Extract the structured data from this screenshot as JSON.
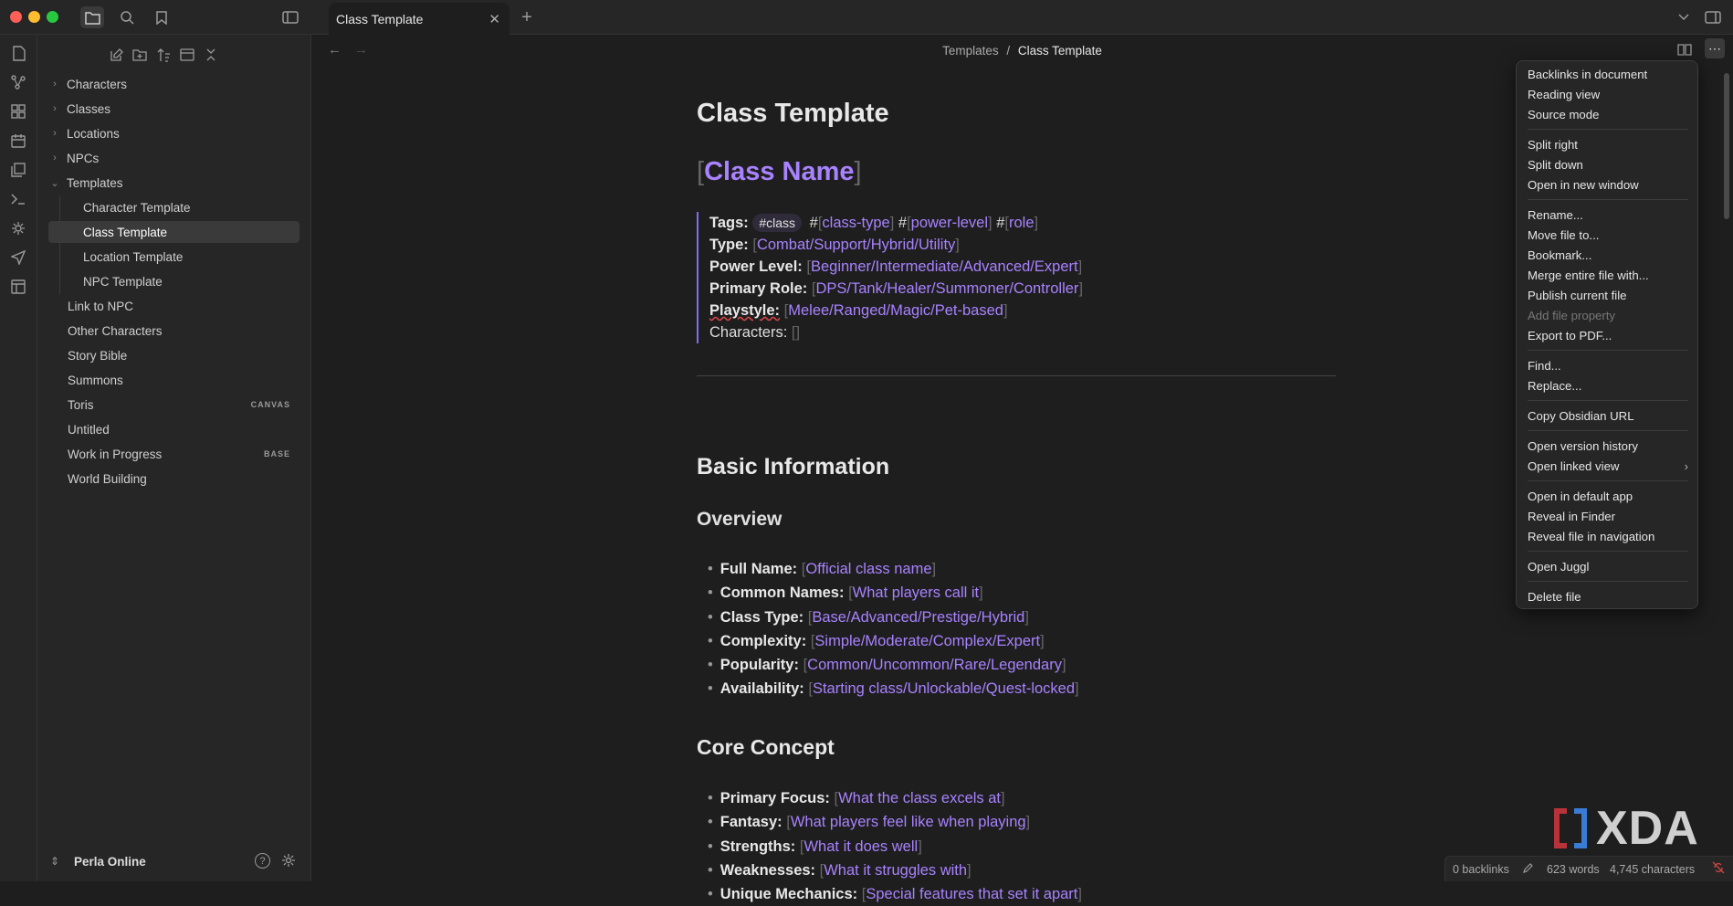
{
  "window": {
    "tab_title": "Class Template"
  },
  "sidebar": {
    "tree": [
      {
        "label": "Characters",
        "folder": true,
        "open": false
      },
      {
        "label": "Classes",
        "folder": true,
        "open": false
      },
      {
        "label": "Locations",
        "folder": true,
        "open": false
      },
      {
        "label": "NPCs",
        "folder": true,
        "open": false
      },
      {
        "label": "Templates",
        "folder": true,
        "open": true
      },
      {
        "label": "Character Template",
        "child": true
      },
      {
        "label": "Class Template",
        "child": true,
        "selected": true
      },
      {
        "label": "Location Template",
        "child": true
      },
      {
        "label": "NPC Template",
        "child": true
      },
      {
        "label": "Link to NPC"
      },
      {
        "label": "Other Characters"
      },
      {
        "label": "Story Bible"
      },
      {
        "label": "Summons"
      },
      {
        "label": "Toris",
        "badge": "CANVAS"
      },
      {
        "label": "Untitled"
      },
      {
        "label": "Work in Progress",
        "badge": "BASE"
      },
      {
        "label": "World Building"
      }
    ],
    "vault_name": "Perla Online"
  },
  "breadcrumb": {
    "parent": "Templates",
    "sep": "/",
    "current": "Class Template"
  },
  "note": {
    "title": "Class Template",
    "class_name": "Class Name",
    "callout": {
      "tags_label": "Tags:",
      "tag_pill": "#class",
      "tag_parts": [
        "class-type",
        "power-level",
        "role"
      ],
      "type_label": "Type:",
      "type_value": "Combat/Support/Hybrid/Utility",
      "power_label": "Power Level:",
      "power_value": "Beginner/Intermediate/Advanced/Expert",
      "role_label": "Primary Role:",
      "role_value": "DPS/Tank/Healer/Summoner/Controller",
      "playstyle_label": "Playstyle:",
      "playstyle_value": "Melee/Ranged/Magic/Pet-based",
      "characters_label": "Characters:",
      "characters_value": "[]"
    },
    "basic_info_heading": "Basic Information",
    "overview_heading": "Overview",
    "overview_items": [
      {
        "label": "Full Name:",
        "value": "Official class name"
      },
      {
        "label": "Common Names:",
        "value": "What players call it"
      },
      {
        "label": "Class Type:",
        "value": "Base/Advanced/Prestige/Hybrid"
      },
      {
        "label": "Complexity:",
        "value": "Simple/Moderate/Complex/Expert"
      },
      {
        "label": "Popularity:",
        "value": "Common/Uncommon/Rare/Legendary"
      },
      {
        "label": "Availability:",
        "value": "Starting class/Unlockable/Quest-locked"
      }
    ],
    "core_concept_heading": "Core Concept",
    "core_items": [
      {
        "label": "Primary Focus:",
        "value": "What the class excels at"
      },
      {
        "label": "Fantasy:",
        "value": "What players feel like when playing"
      },
      {
        "label": "Strengths:",
        "value": "What it does well"
      },
      {
        "label": "Weaknesses:",
        "value": "What it struggles with"
      },
      {
        "label": "Unique Mechanics:",
        "value": "Special features that set it apart"
      }
    ]
  },
  "menu": {
    "groups": [
      [
        "Backlinks in document",
        "Reading view",
        "Source mode"
      ],
      [
        "Split right",
        "Split down",
        "Open in new window"
      ],
      [
        "Rename...",
        "Move file to...",
        "Bookmark...",
        "Merge entire file with...",
        "Publish current file",
        "Add file property",
        "Export to PDF..."
      ],
      [
        "Find...",
        "Replace..."
      ],
      [
        "Copy Obsidian URL"
      ],
      [
        "Open version history",
        "Open linked view"
      ],
      [
        "Open in default app",
        "Reveal in Finder",
        "Reveal file in navigation"
      ],
      [
        "Open Juggl"
      ],
      [
        "Delete file"
      ]
    ],
    "disabled": [
      "Add file property"
    ],
    "submenu": [
      "Open linked view"
    ]
  },
  "status": {
    "backlinks": "0 backlinks",
    "words": "623 words",
    "characters": "4,745 characters"
  },
  "watermark": "XDA",
  "colors": {
    "accent": "#a882ff",
    "callout_border": "#7f6df2",
    "background": "#1e1e1e",
    "panel": "#262626"
  }
}
